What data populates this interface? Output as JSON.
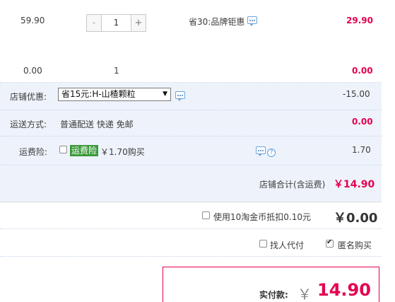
{
  "item1": {
    "unit_price": "59.90",
    "quantity": "1",
    "minus_label": "-",
    "plus_label": "+",
    "promo": "省30:品牌钜惠",
    "subtotal": "29.90"
  },
  "item2": {
    "unit_price": "0.00",
    "quantity": "1",
    "subtotal": "0.00"
  },
  "shop_discount": {
    "label": "店铺优惠:",
    "selected_option": "省15元:H-山楂颗粒",
    "amount": "-15.00"
  },
  "shipping": {
    "label": "运送方式:",
    "value": "普通配送 快递 免邮",
    "amount": "0.00"
  },
  "insurance": {
    "label": "运费险:",
    "tag": "运费险",
    "price_text": "￥1.70购买",
    "amount": "1.70"
  },
  "shop_total": {
    "label": "店铺合计(含运费)",
    "amount": "￥14.90"
  },
  "coins": {
    "label": "使用10淘金币抵扣0.10元",
    "amount": "￥0.00"
  },
  "options": {
    "proxy_pay": "找人代付",
    "anonymous": "匿名购买"
  },
  "payment": {
    "label": "实付款:",
    "currency": "￥",
    "amount": "14.90"
  },
  "colors": {
    "accent_red": "#e5004f",
    "panel_blue": "#eef3fb",
    "tag_green": "#3b9a3b"
  }
}
